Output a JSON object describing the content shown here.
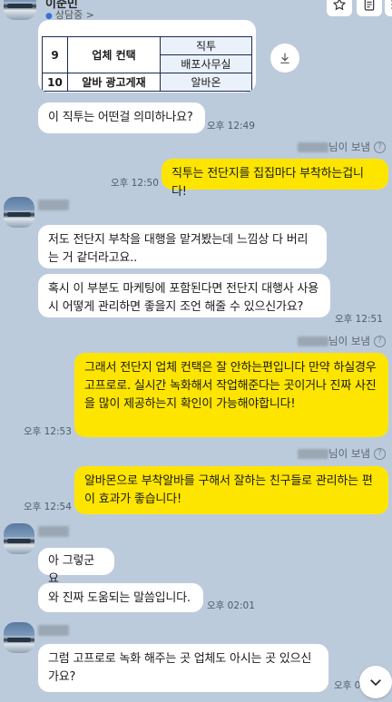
{
  "header": {
    "name": "이준민",
    "status": "상담중 >",
    "buttons": [
      "star-icon",
      "document-icon",
      "menu-icon"
    ]
  },
  "table_image": {
    "rows": [
      {
        "no": "9",
        "category": "업체 컨택",
        "items": [
          "직투",
          "배포사무실"
        ]
      },
      {
        "no": "10",
        "category": "알바 광고게재",
        "items": [
          "알바온"
        ]
      }
    ]
  },
  "messages": [
    {
      "side": "left",
      "text": "이 직투는 어떤걸 의미하나요?",
      "time": "오후 12:49"
    },
    {
      "side": "right",
      "sender_suffix": "님이 보냄",
      "text": "직투는 전단지를 집집마다 부착하는겁니다!",
      "time": "오후 12:50"
    },
    {
      "side": "left",
      "text": "저도 전단지 부착을 대행을 맡겨봤는데 느낌상 다 버리는 거 같더라고요..",
      "time": ""
    },
    {
      "side": "left",
      "text": "혹시 이 부분도 마케팅에 포함된다면 전단지 대행사 사용 시 어떻게 관리하면 좋을지 조언 해줄 수 있으신가요?",
      "time": "오후 12:51"
    },
    {
      "side": "right",
      "sender_suffix": "님이 보냄",
      "text": "그래서 전단지 업체 컨택은 잘 안하는편입니다 만약 하실경우 고프로로. 실시간 녹화해서 작업해준다는 곳이거나 진짜 사진을 많이 제공하는지 확인이 가능해야합니다!",
      "time": "오후 12:53"
    },
    {
      "side": "right",
      "sender_suffix": "님이 보냄",
      "text": "알바몬으로 부착알바를 구해서 잘하는 친구들로 관리하는 편이 효과가 좋습니다!",
      "time": "오후 12:54"
    },
    {
      "side": "left",
      "text": "아 그렇군요",
      "time": ""
    },
    {
      "side": "left",
      "text": "와 진짜 도움되는 말씀입니다.",
      "time": "오후 02:01"
    },
    {
      "side": "left",
      "text": "그럼 고프로로 녹화 해주는 곳 업체도 아시는 곳 있으신가요?",
      "time": "오후 02:"
    }
  ],
  "colors": {
    "background": "#bccbdc",
    "my_bubble": "#fee500",
    "their_bubble": "#ffffff"
  }
}
